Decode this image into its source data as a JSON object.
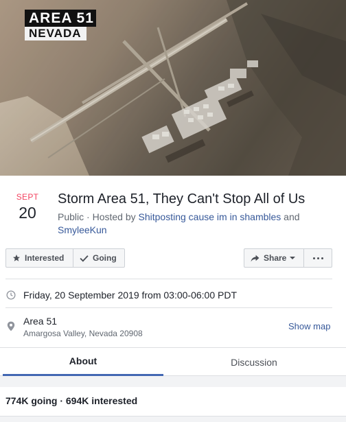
{
  "cover": {
    "caption_line1": "AREA 51",
    "caption_line2": "NEVADA"
  },
  "event": {
    "month": "SEPT",
    "day": "20",
    "title": "Storm Area 51, They Can't Stop All of Us",
    "visibility": "Public",
    "hosted_by_prefix": " · Hosted by ",
    "host_1": "Shitposting cause im in shambles",
    "and_word": " and ",
    "host_2": "SmyleeKun"
  },
  "actions": {
    "interested_label": "Interested",
    "going_label": "Going",
    "share_label": "Share"
  },
  "details": {
    "datetime": "Friday, 20 September 2019 from 03:00-06:00 PDT",
    "location_name": "Area 51",
    "location_address": "Amargosa Valley, Nevada 20908",
    "show_map_label": "Show map"
  },
  "tabs": {
    "about": "About",
    "discussion": "Discussion"
  },
  "stats": {
    "summary": "774K going · 694K interested"
  },
  "icons": {
    "interested": "star-icon",
    "going": "check-icon",
    "share": "share-arrow-icon",
    "more": "more-dots-icon",
    "time": "clock-icon",
    "location": "map-pin-icon"
  },
  "colors": {
    "month_red": "#f3425f",
    "link_blue": "#365899",
    "tab_underline": "#4267b2"
  }
}
